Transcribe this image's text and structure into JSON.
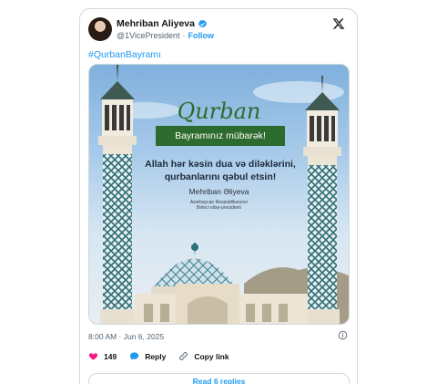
{
  "author": {
    "name": "Mehriban Aliyeva",
    "handle": "@1VicePresident",
    "follow_label": "Follow"
  },
  "post": {
    "hashtag": "#QurbanBayramı",
    "timestamp": "8:00 AM · Jun 6, 2025"
  },
  "image": {
    "title": "Qurban",
    "banner": "Bayramınız mübarək!",
    "wish_line1": "Allah hər kəsin dua və diləklərini,",
    "wish_line2": "qurbanlarını qəbul etsin!",
    "signature": "Mehriban Əliyeva",
    "role_line1": "Azərbaycan Respublikasının",
    "role_line2": "Birinci vitse-prezidenti"
  },
  "actions": {
    "likes": "149",
    "reply_label": "Reply",
    "copy_link_label": "Copy link"
  },
  "read_replies_label": "Read 6 replies",
  "colors": {
    "link": "#1d9bf0",
    "like": "#f91880",
    "banner": "#2e6b2e"
  }
}
